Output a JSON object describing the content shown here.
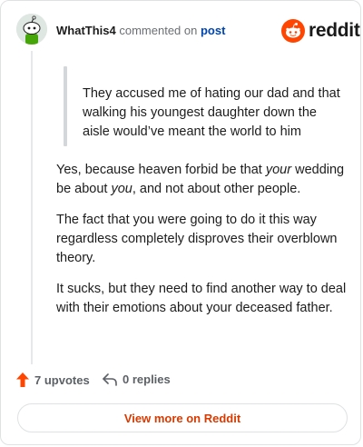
{
  "header": {
    "username": "WhatThis4",
    "commented_on": "commented on",
    "post_link": "post",
    "logo_text": "reddit"
  },
  "comment": {
    "quote": "They accused me of hating our dad and that walking his youngest daughter down the aisle would’ve meant the world to him",
    "paragraph1": {
      "part1": "Yes, because heaven forbid be that ",
      "em1": "your",
      "part2": " wedding be about ",
      "em2": "you",
      "part3": ", and not about other people."
    },
    "paragraph2": "The fact that you were going to do it this way regardless completely disproves their overblown theory.",
    "paragraph3": "It sucks, but they need to find another way to deal with their emotions about your deceased father."
  },
  "footer": {
    "upvotes": "7 upvotes",
    "replies": "0 replies",
    "view_more": "View more on Reddit"
  },
  "colors": {
    "brand": "#ff4500",
    "link": "#0045ac",
    "view_more": "#d93a00"
  },
  "icons": {
    "upvote": "upvote-arrow-icon",
    "reply": "reply-arrow-icon",
    "logo": "reddit-snoo-icon",
    "avatar": "snoo-avatar-icon"
  }
}
